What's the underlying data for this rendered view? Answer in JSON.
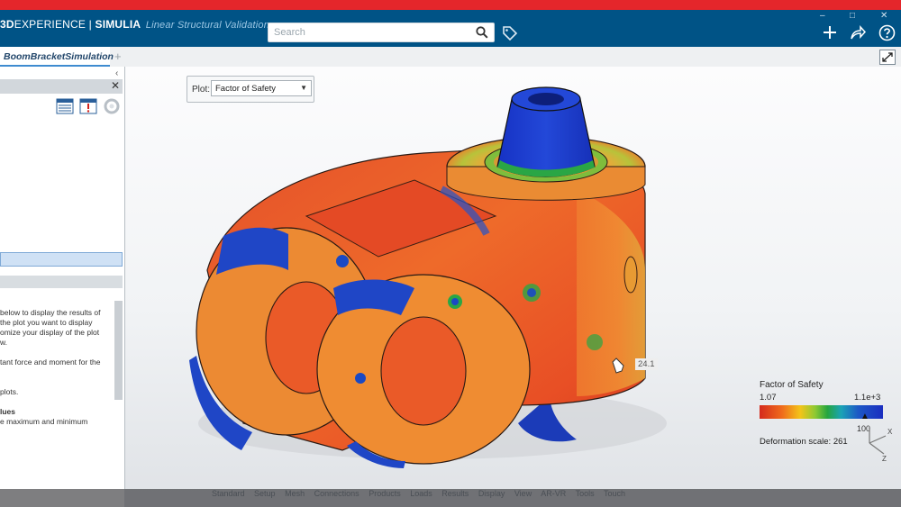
{
  "window": {
    "controls": [
      "–",
      "□",
      "✕"
    ]
  },
  "header": {
    "brand_prefix": "3D",
    "brand_experience": "EXPERIENCE",
    "brand_separator": " | ",
    "brand_company": "SIMULIA",
    "app_name": "Linear Structural Validation",
    "search_placeholder": "Search"
  },
  "tabs": {
    "active": "BoomBracketSimulation",
    "add": "+"
  },
  "panel": {
    "collapse": "‹",
    "close": "✕",
    "help_lines": [
      "below to display the results of",
      "the plot you want to display",
      "omize your display of the plot",
      "w.",
      "",
      "tant force and moment for the",
      "",
      "",
      "plots.",
      "",
      "lues",
      "e maximum and minimum"
    ]
  },
  "plot": {
    "label": "Plot:",
    "value": "Factor of Safety"
  },
  "viewport": {
    "probe_value": "24.1"
  },
  "legend": {
    "title": "Factor of Safety",
    "min": "1.07",
    "max": "1.1e+3",
    "marker": "100",
    "deformation": "Deformation scale: 261",
    "colors": [
      "#d42a1d",
      "#ef6a1c",
      "#f3c419",
      "#8ec933",
      "#25a53f",
      "#1aa3b5",
      "#1c58c6",
      "#1b2ec0"
    ]
  },
  "triad": {
    "x": "X",
    "z": "Z"
  },
  "bottom_tabs": [
    "Standard",
    "Setup",
    "Mesh",
    "Connections",
    "Products",
    "Loads",
    "Results",
    "Display",
    "View",
    "AR-VR",
    "Tools",
    "Touch"
  ],
  "colors": {
    "topbar": "#005386",
    "redbar": "#e4262b",
    "accent": "#3e8bd0"
  }
}
